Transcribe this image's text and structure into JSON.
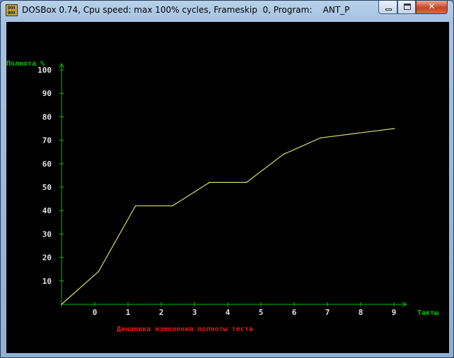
{
  "window": {
    "title": "DOSBox 0.74, Cpu speed: max 100% cycles, Frameskip  0, Program:    ANT_P",
    "icon_text_top": "DOS",
    "icon_text_bottom": "BOX",
    "controls": {
      "minimize_icon": "minimize-icon",
      "maximize_icon": "maximize-icon",
      "close_icon": "close-icon",
      "close_glyph": "✕"
    }
  },
  "colors": {
    "axis": "#00c000",
    "line": "#d8d870",
    "tick_text": "#e0e0e0",
    "caption": "#e01818"
  },
  "chart_data": {
    "type": "line",
    "ylabel": "Полнота %",
    "xlabel": "Такты",
    "caption": "Динамика изменения полноты теста",
    "y_ticks": [
      "10",
      "20",
      "30",
      "40",
      "50",
      "60",
      "70",
      "80",
      "90",
      "100"
    ],
    "x_ticks": [
      "0",
      "0",
      "1",
      "2",
      "3",
      "4",
      "5",
      "6",
      "7",
      "8",
      "9"
    ],
    "ylim": [
      0,
      100
    ],
    "series": [
      {
        "values": [
          0,
          14,
          42,
          42,
          52,
          52,
          64,
          71,
          73,
          75
        ]
      }
    ]
  }
}
